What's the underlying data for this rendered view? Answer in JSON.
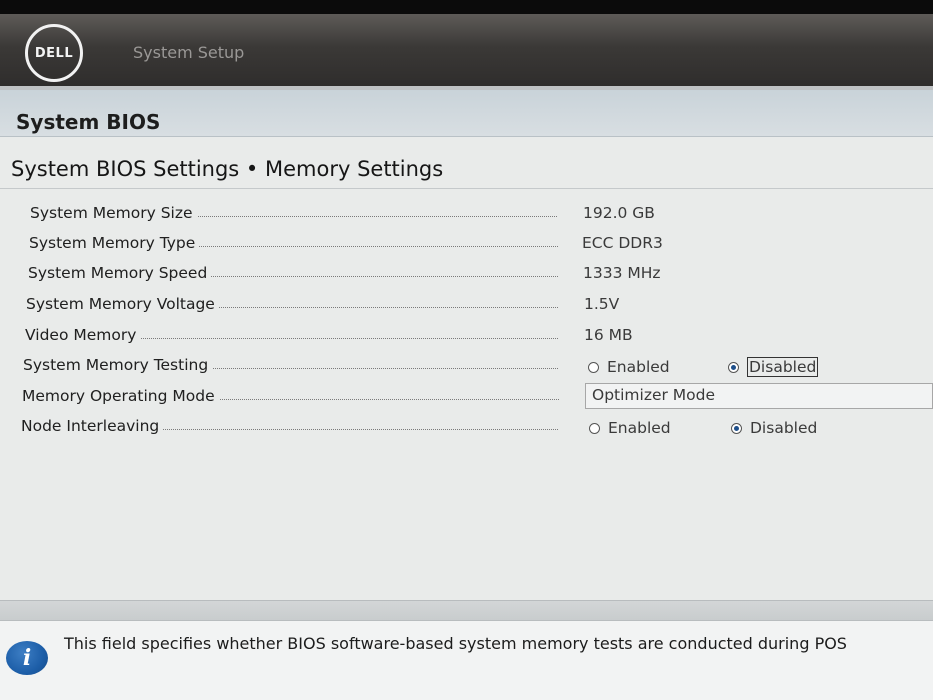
{
  "header": {
    "logo_text": "DELL",
    "title": "System Setup"
  },
  "section": {
    "title": "System BIOS"
  },
  "page": {
    "title": "System BIOS Settings • Memory Settings"
  },
  "settings": {
    "memory_size": {
      "label": "System Memory Size",
      "value": "192.0 GB"
    },
    "memory_type": {
      "label": "System Memory Type",
      "value": "ECC DDR3"
    },
    "memory_speed": {
      "label": "System Memory Speed",
      "value": "1333 MHz"
    },
    "memory_voltage": {
      "label": "System Memory Voltage",
      "value": "1.5V"
    },
    "video_memory": {
      "label": "Video Memory",
      "value": "16 MB"
    },
    "memory_testing": {
      "label": "System Memory Testing",
      "options": [
        "Enabled",
        "Disabled"
      ],
      "selected": "Disabled"
    },
    "operating_mode": {
      "label": "Memory Operating Mode",
      "value": "Optimizer Mode"
    },
    "node_interleaving": {
      "label": "Node Interleaving",
      "options": [
        "Enabled",
        "Disabled"
      ],
      "selected": "Disabled"
    }
  },
  "help": {
    "icon": "info-icon",
    "icon_glyph": "i",
    "text": "This field specifies whether BIOS software-based system memory tests are conducted during POS"
  },
  "colors": {
    "header_bg": "#3b3937",
    "section_band": "#d0d9de",
    "page_bg": "#e9ebea",
    "info_blue": "#1d5ea8"
  }
}
